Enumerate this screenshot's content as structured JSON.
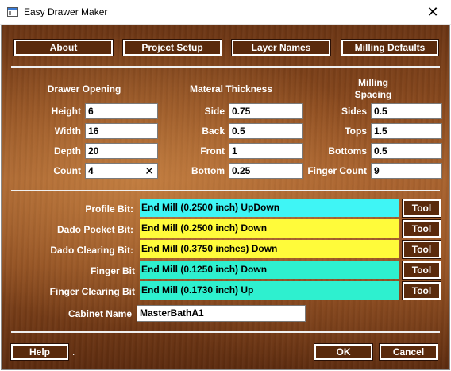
{
  "window": {
    "title": "Easy Drawer Maker",
    "close_glyph": "✕"
  },
  "top_buttons": {
    "about": "About",
    "project_setup": "Project Setup",
    "layer_names": "Layer Names",
    "milling_defaults": "Milling Defaults"
  },
  "drawer_opening": {
    "header": "Drawer Opening",
    "height_label": "Height",
    "height_value": "6",
    "width_label": "Width",
    "width_value": "16",
    "depth_label": "Depth",
    "depth_value": "20",
    "count_label": "Count",
    "count_value": "4",
    "clear_glyph": "✕"
  },
  "material_thickness": {
    "header": "Materal Thickness",
    "side_label": "Side",
    "side_value": "0.75",
    "back_label": "Back",
    "back_value": "0.5",
    "front_label": "Front",
    "front_value": "1",
    "bottom_label": "Bottom",
    "bottom_value": "0.25"
  },
  "milling_spacing": {
    "header_line1": "Milling",
    "header_line2": "Spacing",
    "sides_label": "Sides",
    "sides_value": "0.5",
    "tops_label": "Tops",
    "tops_value": "1.5",
    "bottoms_label": "Bottoms",
    "bottoms_value": "0.5",
    "finger_count_label": "Finger Count",
    "finger_count_value": "9"
  },
  "bits": {
    "tool_label": "Tool",
    "profile": {
      "label": "Profile Bit:",
      "value": "End Mill (0.2500 inch) UpDown",
      "color": "#3ff5f5"
    },
    "dado_pocket": {
      "label": "Dado Pocket Bit:",
      "value": "End Mill (0.2500 inch) Down",
      "color": "#fffb3a"
    },
    "dado_clearing": {
      "label": "Dado Clearing Bit:",
      "value": "End Mill (0.3750 inches) Down",
      "color": "#fffb3a"
    },
    "finger": {
      "label": "Finger Bit",
      "value": "End Mill (0.1250 inch) Down",
      "color": "#2ef0cf"
    },
    "finger_clearing": {
      "label": "Finger Clearing Bit",
      "value": "End Mill (0.1730 inch) Up",
      "color": "#2ef0cf"
    }
  },
  "cabinet": {
    "label": "Cabinet Name",
    "value": "MasterBathA1"
  },
  "bottom_buttons": {
    "help": "Help",
    "dot": ".",
    "ok": "OK",
    "cancel": "Cancel"
  }
}
